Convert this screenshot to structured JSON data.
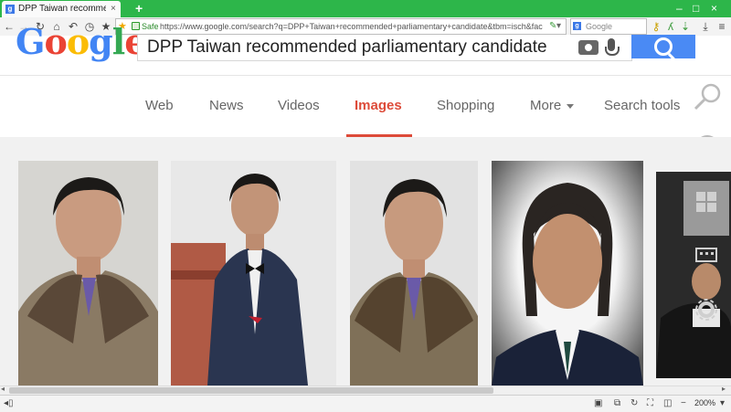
{
  "browser": {
    "tab_title": "DPP Taiwan recommended parli...",
    "tab_close": "×",
    "new_tab": "+",
    "url_security": "Safe",
    "url": "https://www.google.com/search?q=DPP+Taiwan+recommended+parliamentary+candidate&tbm=isch&fac",
    "search_placeholder": "Google",
    "zoom": "200%",
    "window_controls": [
      "–",
      "□",
      "×"
    ]
  },
  "google": {
    "logo": [
      "G",
      "o",
      "o",
      "g",
      "l",
      "e"
    ],
    "logo_colors": [
      "#4285f4",
      "#ea4335",
      "#fbbc05",
      "#4285f4",
      "#34a853",
      "#ea4335"
    ],
    "query": "DPP Taiwan recommended parliamentary candidate"
  },
  "nav": {
    "tabs": [
      "Web",
      "News",
      "Videos",
      "Images",
      "Shopping",
      "More",
      "Search tools"
    ],
    "active": "Images",
    "active_color": "#dd4b39"
  },
  "icons": {
    "toolbar": [
      "back-icon",
      "forward-icon",
      "reload-icon",
      "home-icon",
      "undo-icon",
      "history-icon",
      "bookmark-star-icon"
    ],
    "right_toolbar": [
      "key-icon",
      "translate-icon",
      "download-arrow-icon",
      "menu-icon",
      "download-icon",
      "hamburger-icon"
    ],
    "overlay": [
      "magnifier-icon",
      "share-icon",
      "windows-logo-icon",
      "touch-keyboard-icon",
      "settings-gear-icon"
    ]
  }
}
